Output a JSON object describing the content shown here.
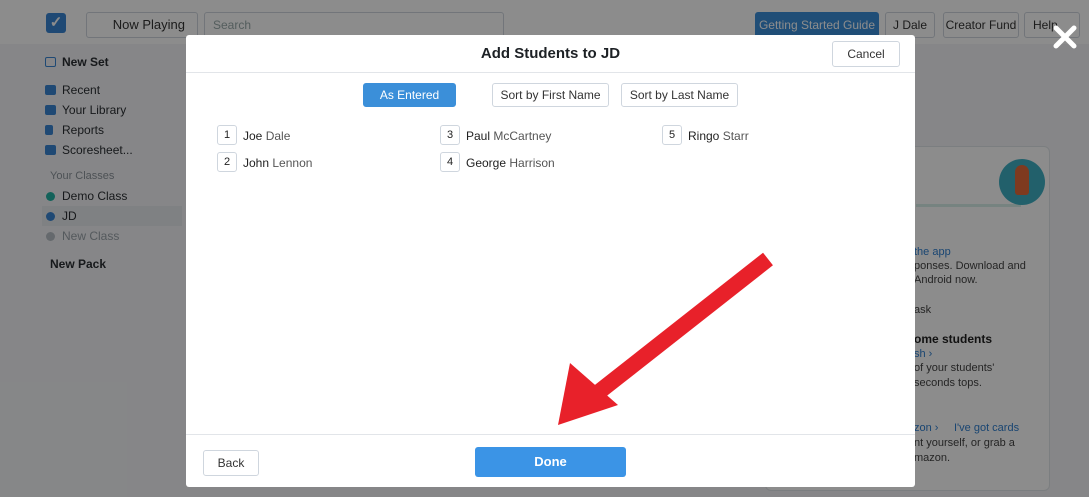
{
  "topbar": {
    "now_playing": "Now Playing",
    "search_placeholder": "Search",
    "guide": "Getting Started Guide",
    "user": "J Dale",
    "fund": "Creator Fund",
    "help": "Help"
  },
  "sidebar": {
    "new_set": "New Set",
    "recent": "Recent",
    "library": "Your Library",
    "reports": "Reports",
    "scoresheet": "Scoresheet...",
    "classes_heading": "Your Classes",
    "demo_class": "Demo Class",
    "jd": "JD",
    "new_class": "New Class",
    "new_pack": "New Pack"
  },
  "right_card": {
    "line1": "the app",
    "line2": "ponses. Download and",
    "line3": "Android now.",
    "line4": "ask",
    "line5": "ome students",
    "line6": "sh ›",
    "line7": "of your students'",
    "line8": "seconds tops.",
    "line9a": "zon ›",
    "line9b": "I've got cards",
    "line10": "nt yourself, or grab a",
    "line11": "mazon."
  },
  "modal": {
    "title": "Add Students to JD",
    "cancel": "Cancel",
    "sort_buttons": [
      "As Entered",
      "Sort by First Name",
      "Sort by Last Name"
    ],
    "students": [
      {
        "num": "1",
        "first": "Joe",
        "last": "Dale"
      },
      {
        "num": "2",
        "first": "John",
        "last": "Lennon"
      },
      {
        "num": "3",
        "first": "Paul",
        "last": "McCartney"
      },
      {
        "num": "4",
        "first": "George",
        "last": "Harrison"
      },
      {
        "num": "5",
        "first": "Ringo",
        "last": "Starr"
      }
    ],
    "back": "Back",
    "done": "Done"
  },
  "colors": {
    "accent": "#3b8fd9",
    "arrow": "#e8212a",
    "overlay": "rgba(0,0,0,0.45)"
  }
}
